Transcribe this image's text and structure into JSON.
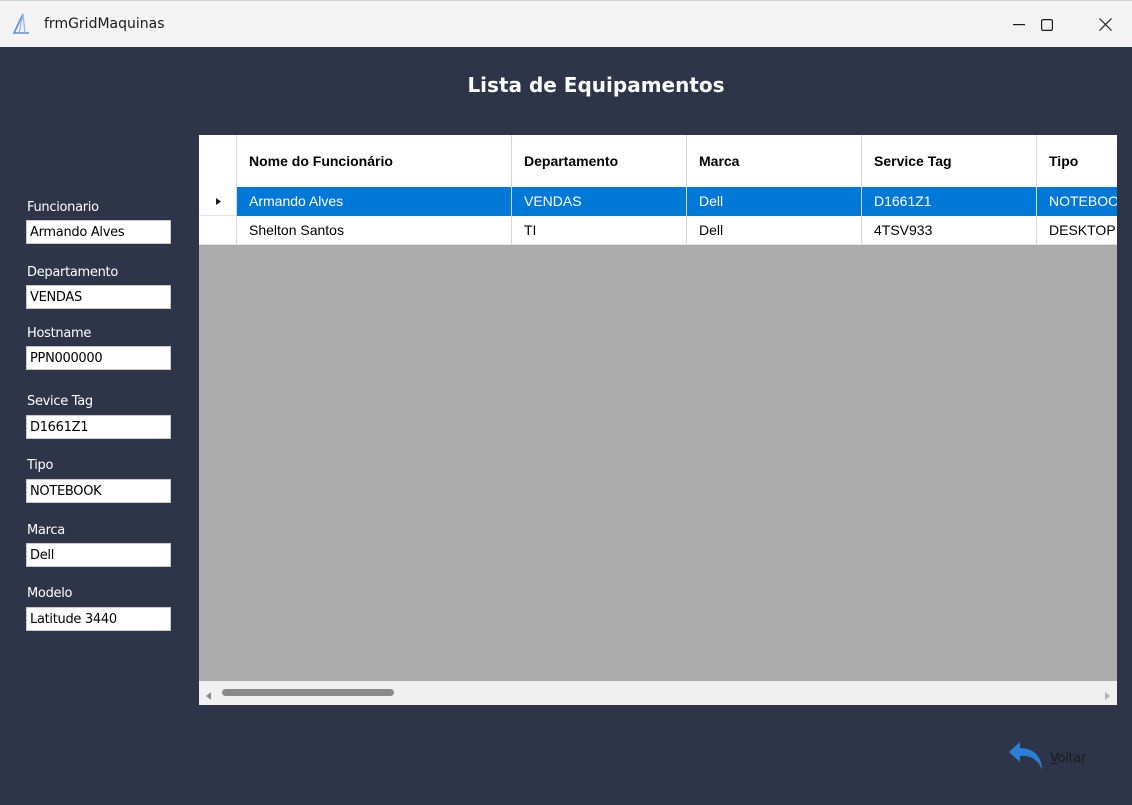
{
  "window": {
    "title": "frmGridMaquinas",
    "controls": {
      "minimize": "minimize-icon",
      "maximize": "maximize-icon",
      "close": "close-icon"
    }
  },
  "heading": "Lista de Equipamentos",
  "form": {
    "fields": [
      {
        "label": "Funcionario",
        "value": "Armando Alves"
      },
      {
        "label": "Departamento",
        "value": "VENDAS"
      },
      {
        "label": "Hostname",
        "value": "PPN000000"
      },
      {
        "label": "Sevice Tag",
        "value": "D1661Z1"
      },
      {
        "label": "Tipo",
        "value": "NOTEBOOK"
      },
      {
        "label": "Marca",
        "value": "Dell"
      },
      {
        "label": "Modelo",
        "value": "Latitude 3440"
      }
    ]
  },
  "grid": {
    "columns": [
      "Nome do Funcionário",
      "Departamento",
      "Marca",
      "Service Tag",
      "Tipo"
    ],
    "rows": [
      {
        "selected": true,
        "cells": [
          "Armando Alves",
          "VENDAS",
          "Dell",
          "D1661Z1",
          "NOTEBOOK"
        ]
      },
      {
        "selected": false,
        "cells": [
          "Shelton Santos",
          "TI",
          "Dell",
          "4TSV933",
          "DESKTOP"
        ]
      }
    ]
  },
  "back_button": {
    "accel": "V",
    "rest": "oltar",
    "icon": "back-arrow-icon"
  },
  "colors": {
    "background": "#2e3548",
    "selection": "#0078d7",
    "grid_empty": "#ababab"
  }
}
